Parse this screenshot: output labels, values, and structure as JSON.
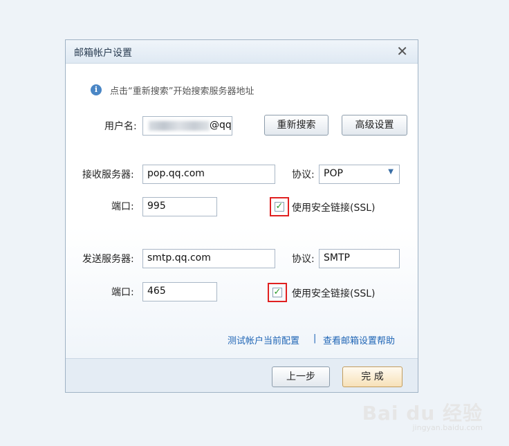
{
  "dialog": {
    "title": "邮箱帐户设置",
    "close_glyph": "✕"
  },
  "info": {
    "text": "点击“重新搜索”开始搜索服务器地址"
  },
  "username": {
    "label": "用户名:",
    "value_suffix": "@qq"
  },
  "buttons": {
    "research": "重新搜索",
    "advanced": "高级设置",
    "prev": "上一步",
    "finish": "完 成"
  },
  "incoming": {
    "label": "接收服务器:",
    "server": "pop.qq.com",
    "protocol_label": "协议:",
    "protocol": "POP",
    "port_label": "端口:",
    "port": "995",
    "ssl_label": "使用安全链接(SSL)",
    "ssl_checked": true
  },
  "outgoing": {
    "label": "发送服务器:",
    "server": "smtp.qq.com",
    "protocol_label": "协议:",
    "protocol": "SMTP",
    "port_label": "端口:",
    "port": "465",
    "ssl_label": "使用安全链接(SSL)",
    "ssl_checked": true
  },
  "links": {
    "test": "测试帐户当前配置",
    "separator": "|",
    "help": "查看邮箱设置帮助"
  },
  "watermark": {
    "main": "Bai du 经验",
    "sub": "jingyan.baidu.com"
  },
  "colors": {
    "highlight": "#e02020",
    "link": "#1f65b5",
    "check": "#2a9a2a"
  }
}
